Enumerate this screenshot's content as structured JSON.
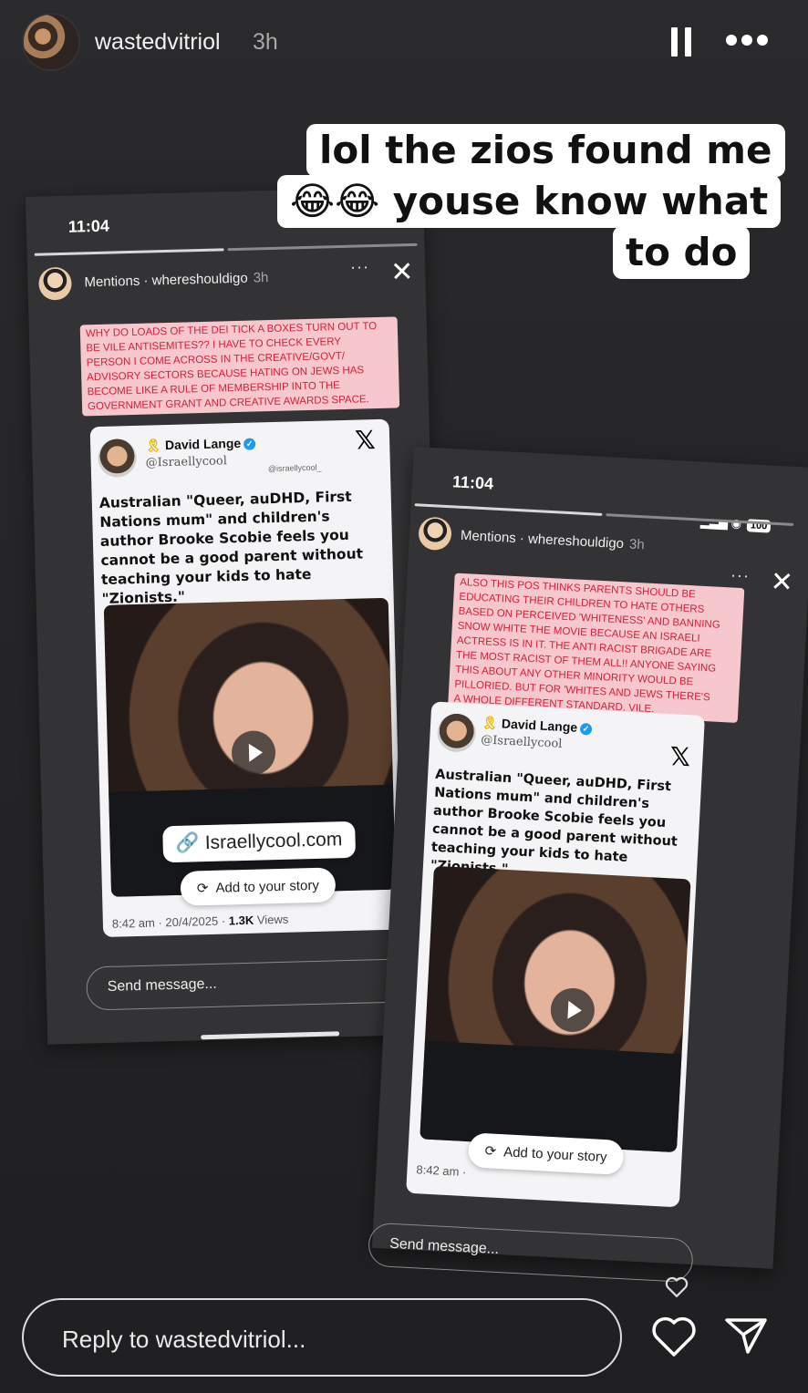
{
  "header": {
    "username": "wastedvitriol",
    "time": "3h",
    "pause_icon": "pause-icon",
    "more_icon": "more-horizontal-icon"
  },
  "caption": {
    "line1": "lol the zios found me",
    "line2_emoji": "😂😂",
    "line2_text": "youse know what",
    "line3": "to do"
  },
  "shot1": {
    "time": "11:04",
    "mention_label": "Mentions · whereshouldigo",
    "mention_time": "3h",
    "menu": "···",
    "close": "✕",
    "pink_text": "WHY DO LOADS OF THE DEI TICK A BOXES TURN OUT TO\nBE VILE ANTISEMITES?? I HAVE TO CHECK EVERY\nPERSON I COME ACROSS IN THE CREATIVE/GOVT/\nADVISORY SECTORS BECAUSE HATING ON JEWS HAS\nBECOME LIKE A RULE OF MEMBERSHIP INTO THE\nGOVERNMENT GRANT AND CREATIVE AWARDS SPACE.",
    "tweet": {
      "name": "David Lange",
      "handle": "@Israellycool",
      "watermark": "@israellycool_",
      "text": "Australian \"Queer, auDHD, First Nations mum\" and children's author Brooke Scobie feels you cannot be a good parent without teaching your kids to hate \"Zionists.\"",
      "link": "Israellycool.com",
      "add_story": "Add to your story",
      "meta_time": "8:42 am · 20/4/2025 · ",
      "views_count": "1.3K",
      "views_label": " Views"
    },
    "send_message": "Send message..."
  },
  "shot2": {
    "time": "11:04",
    "battery": "100",
    "mention_label": "Mentions · whereshouldigo",
    "mention_time": "3h",
    "menu": "···",
    "close": "✕",
    "pink_text": "ALSO THIS POS THINKS PARENTS SHOULD  BE\nEDUCATING THEIR CHILDREN TO HATE OTHERS\nBASED ON PERCEIVED 'WHITENESS' AND BANNING\nSNOW WHITE THE MOVIE BECAUSE AN ISRAELI\nACTRESS IS IN IT.  THE ANTI RACIST BRIGADE ARE\nTHE MOST RACIST OF THEM ALL!!  ANYONE SAYING\nTHIS ABOUT ANY OTHER MINORITY WOULD BE\nPILLORIED. BUT FOR 'WHITES AND JEWS THERE'S\nA WHOLE DIFFERENT STANDARD. VILE.",
    "tweet": {
      "name": "David Lange",
      "handle": "@Israellycool",
      "text": "Australian \"Queer, auDHD, First Nations mum\" and children's author Brooke Scobie feels you cannot be a good parent without teaching your kids to hate \"Zionists.\"",
      "add_story": "Add to your story",
      "meta_time": "8:42 am ·"
    },
    "send_message": "Send message..."
  },
  "footer": {
    "reply_placeholder": "Reply to wastedvitriol...",
    "like_icon": "heart-icon",
    "share_icon": "send-icon"
  }
}
